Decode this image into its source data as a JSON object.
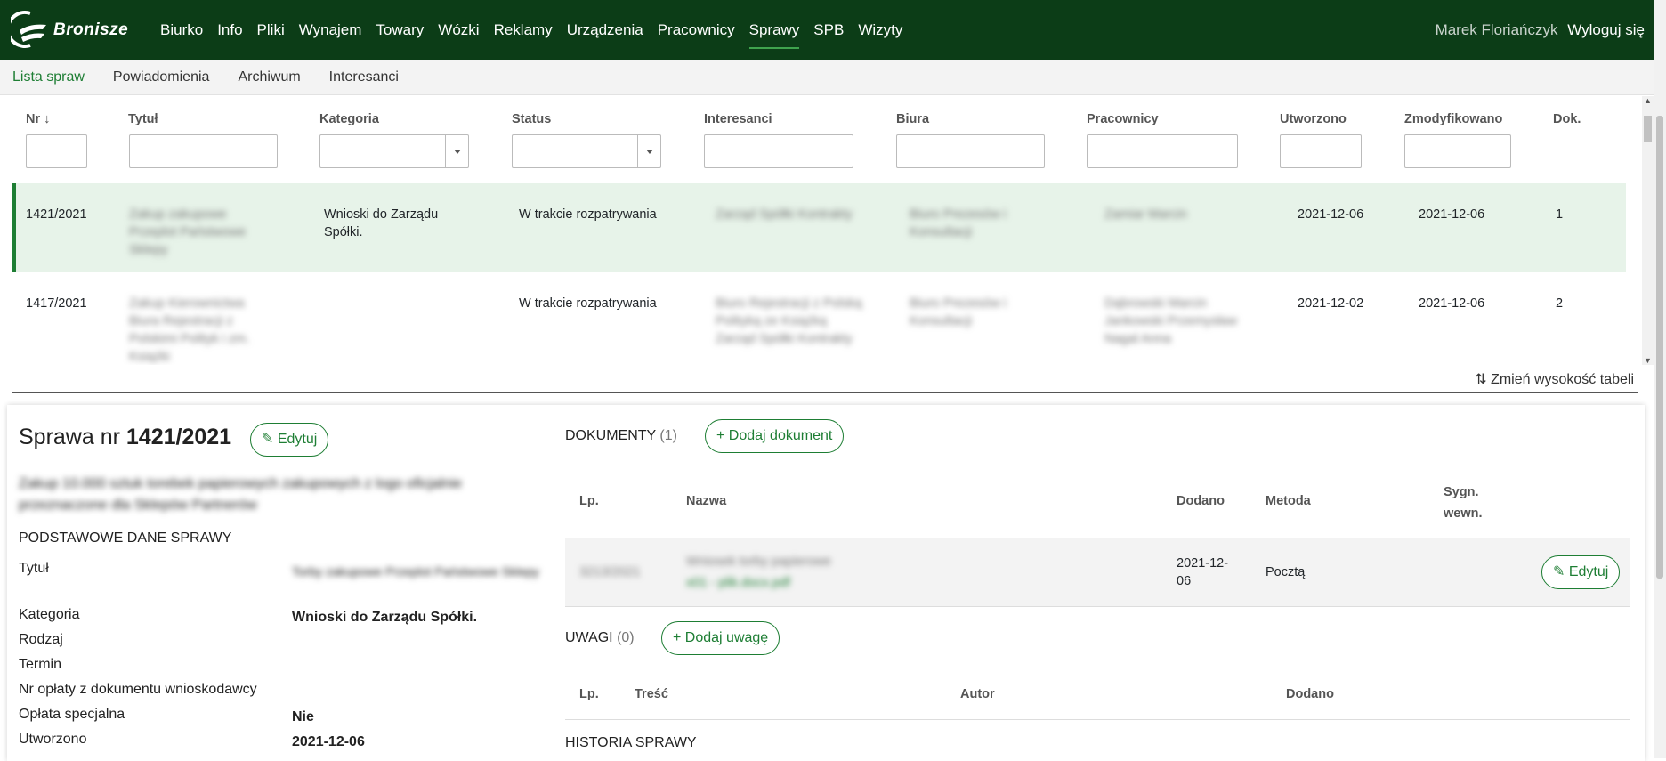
{
  "brand": {
    "name": "Bronisze"
  },
  "nav": {
    "items": [
      "Biurko",
      "Info",
      "Pliki",
      "Wynajem",
      "Towary",
      "Wózki",
      "Reklamy",
      "Urządzenia",
      "Pracownicy",
      "Sprawy",
      "SPB",
      "Wizyty"
    ],
    "active": "Sprawy"
  },
  "user": {
    "name": "Marek Floriańczyk",
    "logout": "Wyloguj się"
  },
  "subnav": {
    "items": [
      "Lista spraw",
      "Powiadomienia",
      "Archiwum",
      "Interesanci"
    ],
    "active": "Lista spraw"
  },
  "table": {
    "columns": [
      "Nr",
      "Tytuł",
      "Kategoria",
      "Status",
      "Interesanci",
      "Biura",
      "Pracownicy",
      "Utworzono",
      "Zmodyfikowano",
      "Dok."
    ],
    "rows": [
      {
        "nr": "1421/2021",
        "tytul": "Zakup zakupowe Przeplot Państwowe Sklepy",
        "kategoria": "Wnioski do Zarządu Spółki.",
        "status": "W trakcie rozpatrywania",
        "interesanci": "Zarząd Spółki Kontrakty",
        "biura": "Biuro Prezesów i Konsultacji",
        "pracownicy": "Zamiar Marcin",
        "utworzono": "2021-12-06",
        "zmodyfikowano": "2021-12-06",
        "dok": "1"
      },
      {
        "nr": "1417/2021",
        "tytul": "Zakup Kierownictwa Biura Rejestracji z Polskimi Polityk i zm. Książki",
        "kategoria": "",
        "status": "W trakcie rozpatrywania",
        "interesanci": "Biuro Rejestracji z Polską Polityką ze Książką Zarząd Spółki Kontrakty",
        "biura": "Biuro Prezesów i Konsultacji",
        "pracownicy": "Dąbrowski Marcin Jankowski Przemysław Nagal Anna",
        "utworzono": "2021-12-02",
        "zmodyfikowano": "2021-12-06",
        "dok": "2"
      }
    ]
  },
  "resize_label": "⇅ Zmień wysokość tabeli",
  "detail": {
    "title_prefix": "Sprawa nr ",
    "title_nr": "1421/2021",
    "edit": "Edytuj",
    "desc": "Zakup 10.000 sztuk torebek papierowych zakupowych z logo oficjalnie przeznaczone dla Sklepów Partnerów",
    "basic_header": "PODSTAWOWE DANE SPRAWY",
    "fields": [
      {
        "label": "Tytuł",
        "value": "Torby zakupowe Przeplot Państwowe Sklepy"
      },
      {
        "label": "Kategoria",
        "value": "Wnioski do Zarządu Spółki."
      },
      {
        "label": "Rodzaj",
        "value": ""
      },
      {
        "label": "Termin",
        "value": ""
      },
      {
        "label": "Nr opłaty z dokumentu wnioskodawcy",
        "value": ""
      },
      {
        "label": "Opłata specjalna",
        "value": "Nie"
      },
      {
        "label": "Utworzono",
        "value": "2021-12-06"
      }
    ],
    "docs": {
      "title": "DOKUMENTY",
      "count": "(1)",
      "add": "+ Dodaj dokument",
      "columns": [
        "Lp.",
        "Nazwa",
        "Dodano",
        "Metoda",
        "Sygn. wewn."
      ],
      "rows": [
        {
          "lp": "3213/2021",
          "nazwa": "Wniosek torby papierowe",
          "link": "x01 - plik.docx.pdf",
          "dodano": "2021-12-06",
          "metoda": "Pocztą",
          "edit": "Edytuj"
        }
      ]
    },
    "notes": {
      "title": "UWAGI",
      "count": "(0)",
      "add": "+ Dodaj uwagę",
      "columns": [
        "Lp.",
        "Treść",
        "Autor",
        "Dodano"
      ]
    },
    "history": {
      "title": "HISTORIA SPRAWY"
    }
  },
  "colors": {
    "topbar": "#0c3d17",
    "accent": "#1e7e34",
    "selected_row": "#e7f3e9"
  }
}
